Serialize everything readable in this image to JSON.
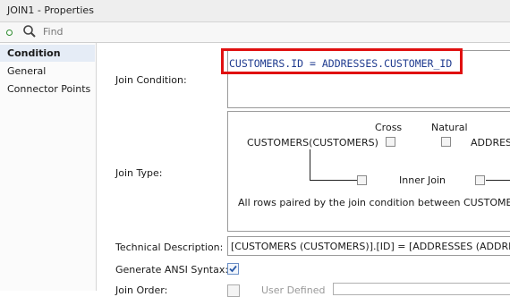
{
  "window": {
    "title": "JOIN1 - Properties"
  },
  "search": {
    "placeholder": "Find"
  },
  "sidebar": {
    "items": [
      {
        "label": "Condition"
      },
      {
        "label": "General"
      },
      {
        "label": "Connector Points"
      }
    ]
  },
  "form": {
    "join_condition": {
      "label": "Join Condition:",
      "value": "CUSTOMERS.ID = ADDRESSES.CUSTOMER_ID"
    },
    "join_type": {
      "label": "Join Type:",
      "cross_label": "Cross",
      "natural_label": "Natural",
      "left_table": "CUSTOMERS(CUSTOMERS)",
      "right_table": "ADDRES",
      "inner_join_label": "Inner Join",
      "description": "All rows paired by the join condition between CUSTOMER"
    },
    "technical_description": {
      "label": "Technical Description:",
      "value": "[CUSTOMERS (CUSTOMERS)].[ID] = [ADDRESSES (ADDRESSE"
    },
    "generate_ansi": {
      "label": "Generate ANSI Syntax:",
      "checked": true
    },
    "join_order": {
      "label": "Join Order:",
      "user_defined_label": "User Defined"
    }
  },
  "colors": {
    "highlight": "#e01010",
    "condition_text": "#1f3b8f",
    "selected_nav_bg": "#e5ecf6"
  }
}
